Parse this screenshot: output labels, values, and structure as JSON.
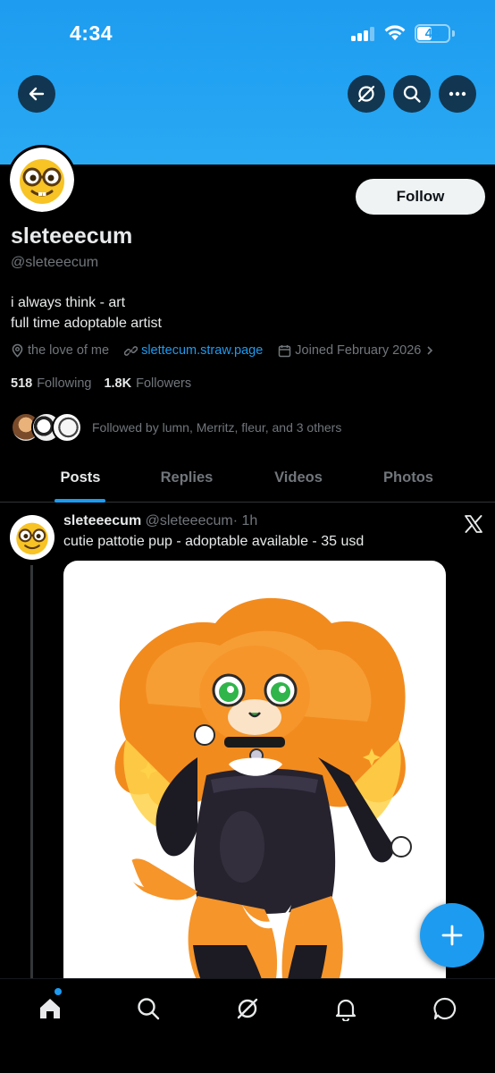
{
  "status_bar": {
    "time": "4:34",
    "battery": "48",
    "battery_level": 0.48
  },
  "header_buttons": {
    "back": "arrow-left-icon",
    "grok": "grok-icon",
    "search": "search-icon",
    "more": "more-icon"
  },
  "profile": {
    "display_name": "sleteeecum",
    "handle": "@sleteeecum",
    "bio_line1": "i always think - art",
    "bio_line2": "full time adoptable artist",
    "location": "the love of me",
    "website": "slettecum.straw.page",
    "joined": "Joined February 2026",
    "following_count": "518",
    "following_label": "Following",
    "followers_count": "1.8K",
    "followers_label": "Followers",
    "followed_by": "Followed by lumn, Merritz, fleur, and 3 others",
    "follow_button": "Follow"
  },
  "tabs": [
    {
      "label": "Posts",
      "active": true
    },
    {
      "label": "Replies",
      "active": false
    },
    {
      "label": "Videos",
      "active": false
    },
    {
      "label": "Photos",
      "active": false
    }
  ],
  "post": {
    "name": "sleteeecum",
    "handle": "@sleteeecum",
    "time": "· 1h",
    "text": "cutie pattotie pup - adoptable available - 35 usd"
  },
  "colors": {
    "accent": "#1d9bf0",
    "banner": "#23a3f2",
    "background": "#000000",
    "muted": "#71767b"
  },
  "nav": [
    "home-icon",
    "search-icon",
    "grok-icon",
    "notifications-icon",
    "messages-icon"
  ]
}
